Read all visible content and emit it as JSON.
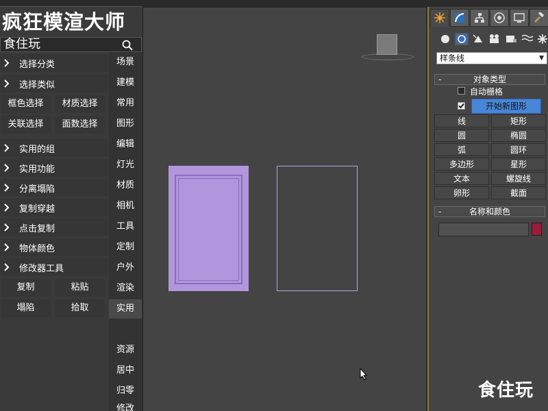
{
  "plugin": {
    "title": "疯狂模渲大师",
    "search_text": "食住玩",
    "categories": [
      "选择分类",
      "选择类似",
      "实用的组",
      "实用功能",
      "分离塌陷",
      "复制穿越",
      "点击复制",
      "物体颜色",
      "修改器工具"
    ],
    "buttons": [
      "框色选择",
      "材质选择",
      "关联选择",
      "面数选择",
      "复制",
      "粘贴",
      "塌陷",
      "拾取"
    ],
    "tabs": [
      "场景",
      "建模",
      "常用",
      "图形",
      "编辑",
      "灯光",
      "材质",
      "相机",
      "工具",
      "定制",
      "户外",
      "渲染",
      "实用",
      "资源",
      "居中",
      "归零",
      "修改"
    ],
    "active_tab": "实用"
  },
  "command_panel": {
    "category_dropdown": "样条线",
    "object_type_title": "对象类型",
    "autogrid_label": "自动栅格",
    "start_new_shape_label": "开始新图形",
    "start_new_shape_checked": true,
    "object_buttons": [
      "线",
      "矩形",
      "圆",
      "椭圆",
      "弧",
      "圆环",
      "多边形",
      "星形",
      "文本",
      "螺旋线",
      "卵形",
      "截面"
    ],
    "name_color_title": "名称和颜色",
    "name_value": "",
    "object_color": "#9b1b3a"
  },
  "watermark": "食住玩",
  "colors": {
    "door_fill": "#b296dd",
    "rect_outline": "#b0a8e6",
    "active_button": "#4a86d8"
  }
}
